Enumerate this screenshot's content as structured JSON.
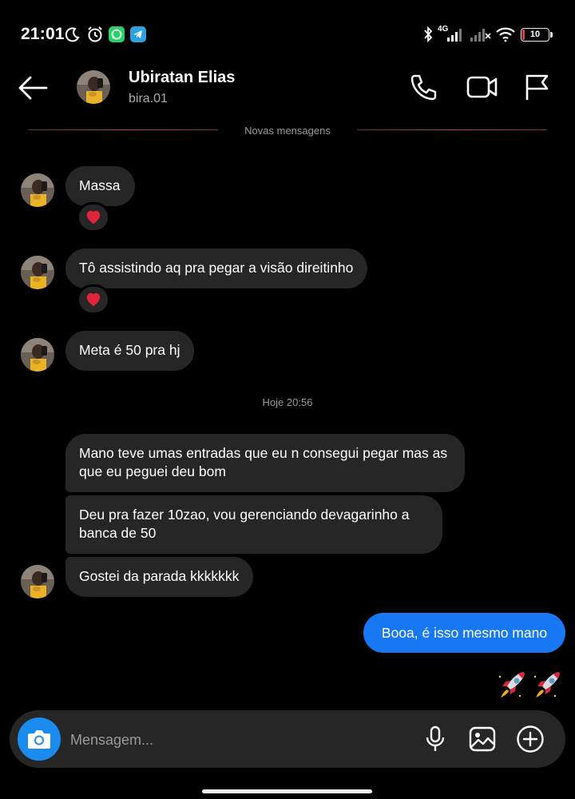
{
  "status_bar": {
    "time": "21:01",
    "network_label": "4G",
    "battery": "10"
  },
  "header": {
    "contact_name": "Ubiratan Elias",
    "contact_username": "bira.01",
    "icons": [
      "back-arrow-icon",
      "phone-icon",
      "video-icon",
      "flag-icon"
    ]
  },
  "divider": {
    "label": "Novas mensagens"
  },
  "messages": [
    {
      "text": "Massa",
      "reaction": "heart"
    },
    {
      "text": "Tô assistindo aq pra pegar a visão direitinho",
      "reaction": "heart"
    },
    {
      "text": "Meta é 50 pra hj"
    }
  ],
  "time_separator": "Hoje 20:56",
  "messages_later": [
    {
      "text": "Mano teve umas entradas que eu n consegui pegar mas as que eu peguei deu bom"
    },
    {
      "text": "Deu pra fazer 10zao, vou gerenciando devagarinho a banca de 50"
    },
    {
      "text": "Gostei da parada kkkkkkk"
    }
  ],
  "sent": {
    "text": "Booa, é isso mesmo mano",
    "reactions": [
      "rocket",
      "rocket"
    ]
  },
  "composer": {
    "placeholder": "Mensagem...",
    "icons": [
      "camera-icon",
      "microphone-icon",
      "gallery-icon",
      "add-icon"
    ]
  },
  "colors": {
    "accent": "#1877f2",
    "bubble": "#262626",
    "heart": "#e0243a"
  }
}
